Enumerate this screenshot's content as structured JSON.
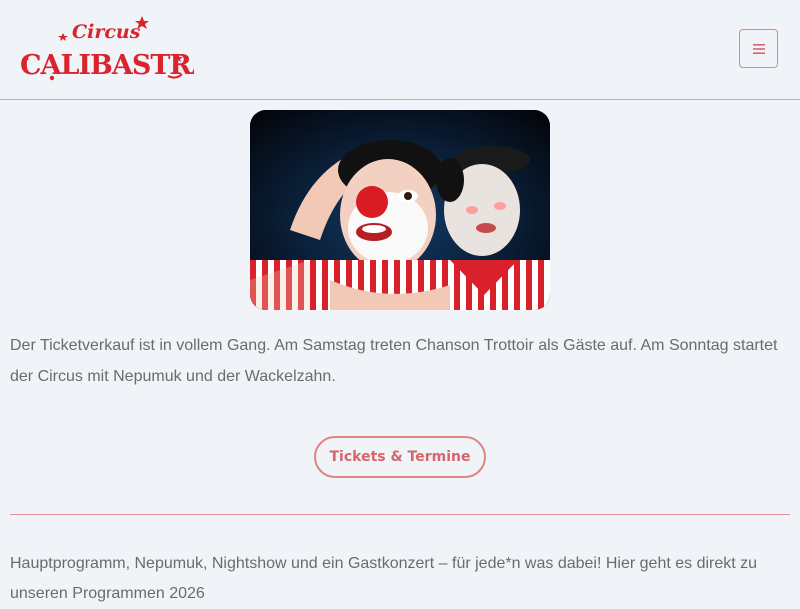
{
  "header": {
    "logo_small": "Circus",
    "logo_large": "CALIBASTRA",
    "menu_icon": "hamburger-icon"
  },
  "hero": {
    "image_description": "two clowns with red noses and striped shirts on stage"
  },
  "intro_text": "Der Ticketverkauf ist in vollem Gang. Am Samstag treten Chanson Trottoir als Gäste auf. Am Sonntag startet der Circus mit Nepumuk und der Wackelzahn.",
  "tickets_button": "Tickets & Termine",
  "programs_text": "Hauptprogramm, Nepumuk, Nightshow und ein Gastkonzert – für jede*n was dabei! Hier geht es direkt zu unseren Programmen 2026",
  "colors": {
    "brand_red": "#d9232d",
    "accent": "#e08585",
    "background": "#f0f3f7"
  }
}
